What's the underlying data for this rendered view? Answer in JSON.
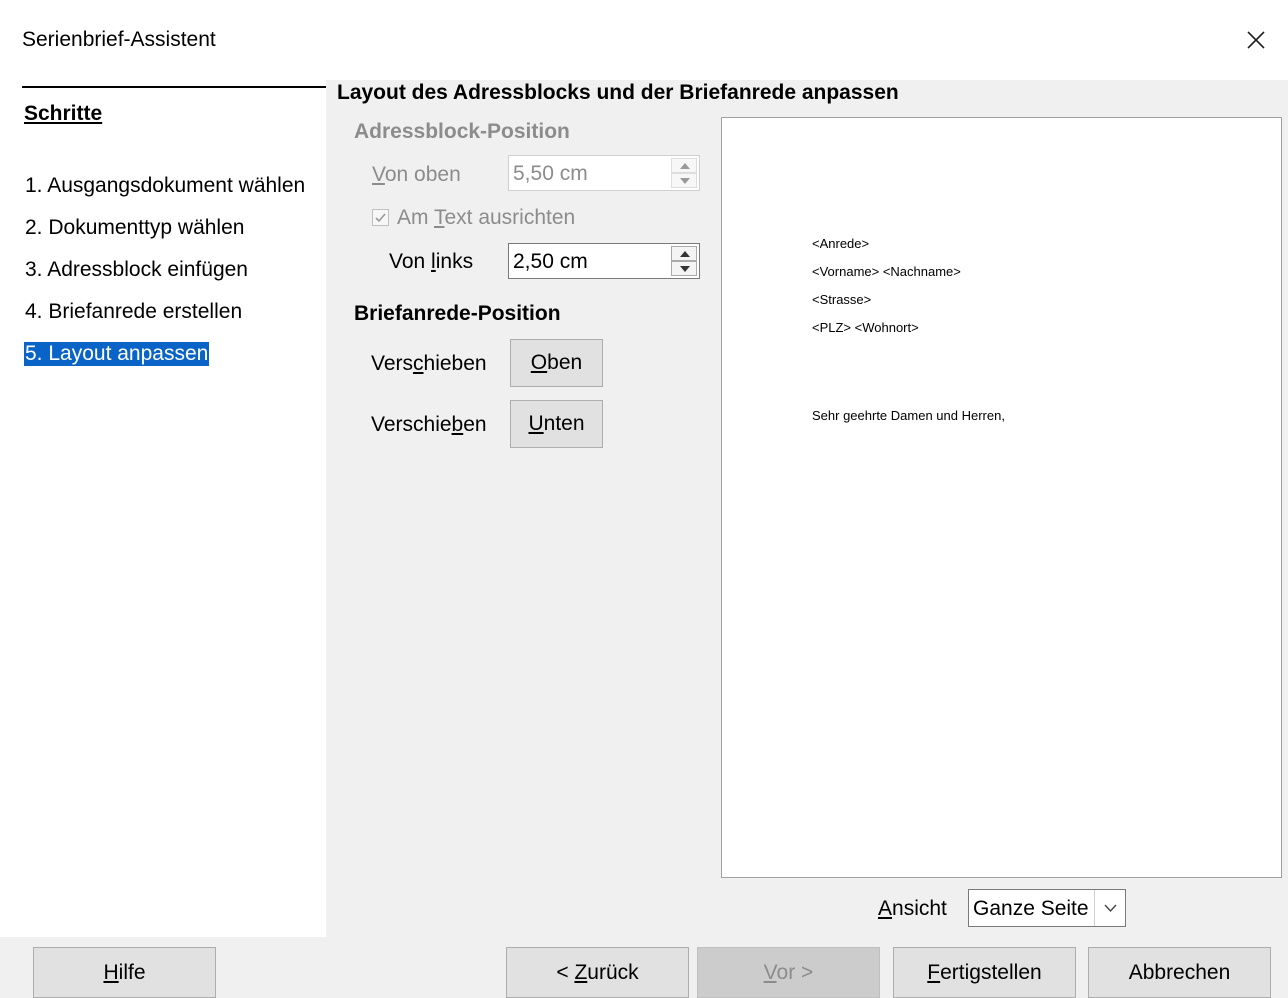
{
  "window": {
    "title": "Serienbrief-Assistent",
    "close_icon": "close-icon"
  },
  "sidebar": {
    "header": "Schritte",
    "steps": [
      {
        "label": "1. Ausgangsdokument wählen",
        "active": false
      },
      {
        "label": "2. Dokumenttyp wählen",
        "active": false
      },
      {
        "label": "3. Adressblock einfügen",
        "active": false
      },
      {
        "label": "4. Briefanrede erstellen",
        "active": false
      },
      {
        "label": "5. Layout anpassen",
        "active": true
      }
    ],
    "accent_color": "#0a64c8"
  },
  "main": {
    "title": "Layout des Adressblocks und der Briefanrede anpassen",
    "address_section": {
      "label": "Adressblock-Position",
      "von_oben": {
        "label_prefix": "",
        "label_u": "V",
        "label_rest": "on oben",
        "value": "5,50 cm",
        "enabled": false
      },
      "align_text": {
        "label_prefix": "Am ",
        "label_u": "T",
        "label_rest": "ext ausrichten",
        "checked": true,
        "enabled": false
      },
      "von_links": {
        "label_prefix": "Von ",
        "label_u": "l",
        "label_rest": "inks",
        "value": "2,50 cm",
        "enabled": true
      }
    },
    "salutation_section": {
      "label": "Briefanrede-Position",
      "move_up": {
        "label_prefix": "Vers",
        "label_u": "c",
        "label_rest": "hieben",
        "btn_u": "O",
        "btn_rest": "ben"
      },
      "move_down": {
        "label_prefix": "Verschie",
        "label_u": "b",
        "label_rest": "en",
        "btn_u": "U",
        "btn_rest": "nten"
      }
    },
    "preview": {
      "address_lines": [
        "<Anrede>",
        "<Vorname> <Nachname>",
        "<Strasse>",
        "<PLZ> <Wohnort>"
      ],
      "salutation": "Sehr geehrte Damen und Herren,"
    },
    "view": {
      "label_u": "A",
      "label_rest": "nsicht",
      "selected": "Ganze Seite"
    }
  },
  "footer": {
    "help": {
      "u": "H",
      "rest": "ilfe"
    },
    "back": {
      "prefix": "< ",
      "u": "Z",
      "rest": "urück"
    },
    "next": {
      "u": "V",
      "rest": "or >",
      "enabled": false
    },
    "finish": {
      "u": "F",
      "rest": "ertigstellen"
    },
    "cancel": {
      "label": "Abbrechen"
    }
  }
}
